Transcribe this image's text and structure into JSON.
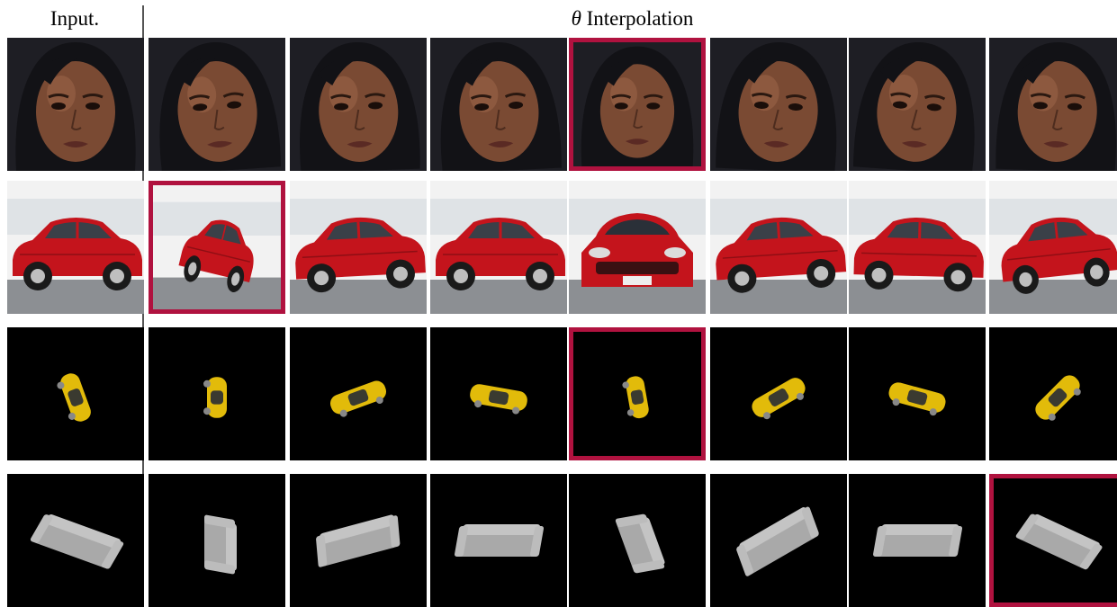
{
  "header": {
    "input_label": "Input.",
    "interp_symbol": "θ",
    "interp_label": "Interpolation"
  },
  "colors": {
    "highlight": "#b0123f",
    "face_background": "#1e1e24",
    "car_red": "#c4141c",
    "car_yellow": "#e2bb0a",
    "sofa_gray": "#a9a9a9",
    "render_background": "#000000"
  },
  "rows": [
    {
      "name": "face-row",
      "subject": "face",
      "selected_column": 4
    },
    {
      "name": "red-car-row",
      "subject": "red-car",
      "selected_column": 1
    },
    {
      "name": "yellow-car-row",
      "subject": "yellow-car",
      "selected_column": 4
    },
    {
      "name": "sofa-row",
      "subject": "sofa",
      "selected_column": 7
    }
  ]
}
